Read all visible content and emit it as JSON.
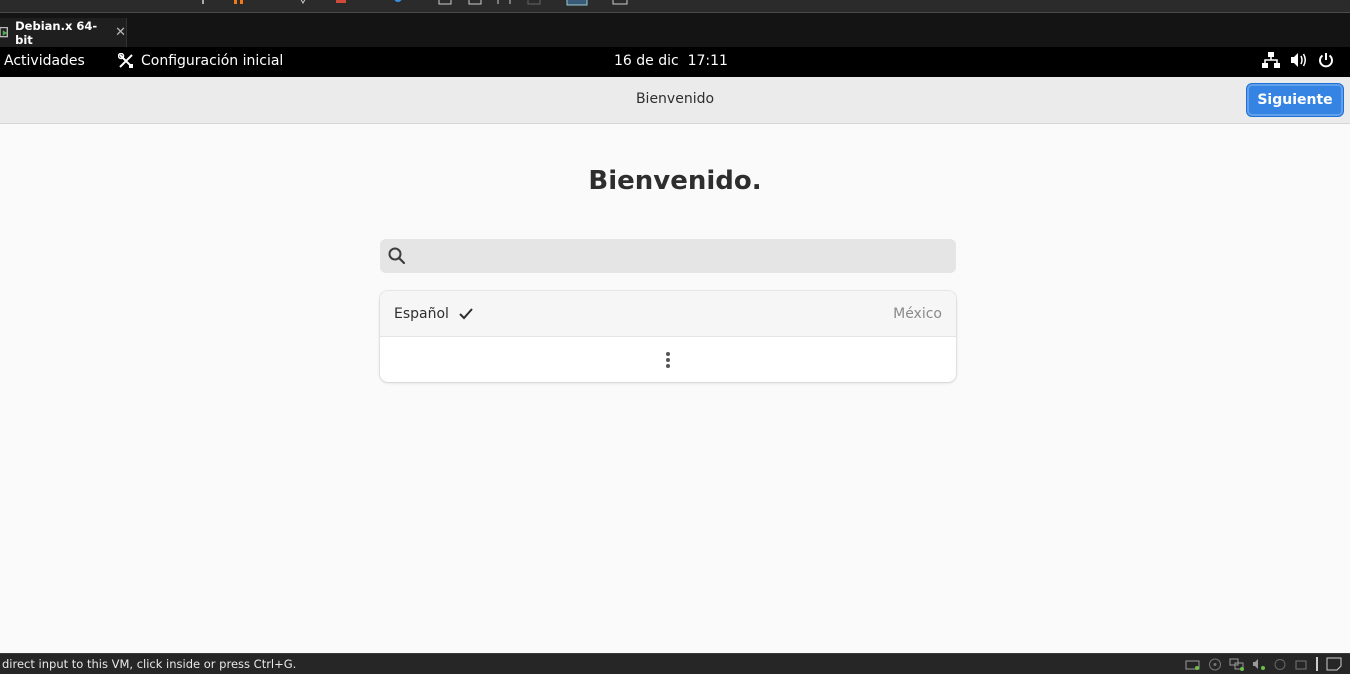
{
  "vm_tab": {
    "title": "Debian.x 64-bit",
    "close_glyph": "✕"
  },
  "gnome_bar": {
    "activities": "Actividades",
    "app_name": "Configuración inicial",
    "clock": "16 de dic  17:11",
    "tray_icons": [
      "network-icon",
      "volume-icon",
      "power-icon"
    ]
  },
  "headerbar": {
    "title": "Bienvenido",
    "next_label": "Siguiente"
  },
  "main": {
    "heading": "Bienvenido.",
    "search": {
      "value": "",
      "placeholder": ""
    },
    "languages": [
      {
        "name": "Español",
        "region": "México",
        "selected": true
      }
    ],
    "more_icon": "view-more-icon"
  },
  "statusbar": {
    "text": "direct input to this VM, click inside or press Ctrl+G."
  },
  "colors": {
    "accent": "#3584e4",
    "topbar": "#000000",
    "headerbar": "#ebebeb",
    "background": "#fafafa"
  }
}
